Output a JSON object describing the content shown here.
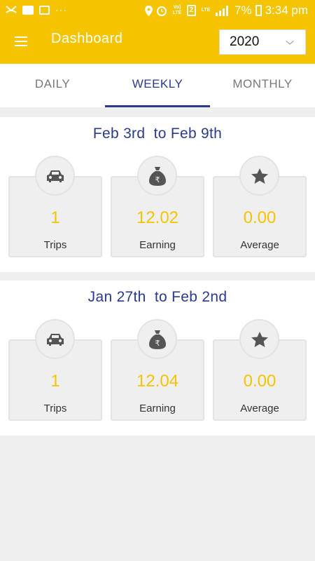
{
  "status_bar": {
    "battery": "7%",
    "time": "3:34 pm",
    "volte": "Vo) LTE",
    "sim": "2",
    "lte": "LTE"
  },
  "header": {
    "title": "Dashboard",
    "year_value": "2020",
    "bg_color": "#f5c400"
  },
  "tabs": [
    {
      "label": "DAILY",
      "active": false
    },
    {
      "label": "WEEKLY",
      "active": true
    },
    {
      "label": "MONTHLY",
      "active": false
    }
  ],
  "weeks": [
    {
      "title": "Feb 3rd  to Feb 9th",
      "stats": [
        {
          "icon": "car-icon",
          "value": "1",
          "label": "Trips"
        },
        {
          "icon": "money-bag-icon",
          "value": "12.02",
          "label": "Earning"
        },
        {
          "icon": "star-icon",
          "value": "0.00",
          "label": "Average"
        }
      ]
    },
    {
      "title": "Jan 27th  to Feb 2nd",
      "stats": [
        {
          "icon": "car-icon",
          "value": "1",
          "label": "Trips"
        },
        {
          "icon": "money-bag-icon",
          "value": "12.04",
          "label": "Earning"
        },
        {
          "icon": "star-icon",
          "value": "0.00",
          "label": "Average"
        }
      ]
    }
  ],
  "colors": {
    "accent": "#f5c400",
    "primary": "#2a3a8c"
  }
}
